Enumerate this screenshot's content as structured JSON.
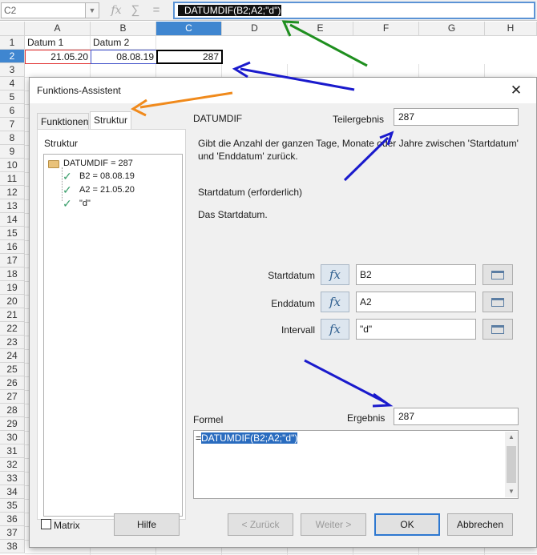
{
  "formula_bar": {
    "name_box": "C2",
    "fx_icon": "fx-icon",
    "sum_icon": "sum-icon",
    "equals_icon": "equals-icon",
    "formula": "=DATUMDIF(B2;A2;\"d\")",
    "formula_prefix": "=",
    "formula_rest": "DATUMDIF(B2;A2;\"d\")"
  },
  "sheet": {
    "columns": [
      "A",
      "B",
      "C",
      "D",
      "E",
      "F",
      "G",
      "H"
    ],
    "selected_column": "C",
    "rows": [
      "1",
      "2",
      "3",
      "4",
      "5",
      "6",
      "7",
      "8",
      "9",
      "10",
      "11",
      "12",
      "13",
      "14",
      "15",
      "16",
      "17",
      "18",
      "19",
      "20",
      "21",
      "22",
      "23",
      "24",
      "25",
      "26",
      "27",
      "28",
      "29",
      "30",
      "31",
      "32",
      "33",
      "34",
      "35",
      "36",
      "37",
      "38"
    ],
    "selected_row": "2",
    "cells": {
      "A1": "Datum 1",
      "B1": "Datum 2",
      "A2": "21.05.20",
      "B2": "08.08.19",
      "C2": "287"
    }
  },
  "dialog": {
    "title": "Funktions-Assistent",
    "close_icon": "close-icon",
    "tabs": [
      {
        "label": "Funktionen",
        "active": false
      },
      {
        "label": "Struktur",
        "active": true
      }
    ],
    "structure_label": "Struktur",
    "tree": [
      {
        "label": "DATUMDIF = 287",
        "icon": "folder-icon"
      },
      {
        "label": "B2 = 08.08.19",
        "icon": "check-icon"
      },
      {
        "label": "A2 = 21.05.20",
        "icon": "check-icon"
      },
      {
        "label": "\"d\"",
        "icon": "check-icon"
      }
    ],
    "function_name": "DATUMDIF",
    "teilergebnis_label": "Teilergebnis",
    "teilergebnis_value": "287",
    "description": "Gibt die Anzahl der ganzen Tage, Monate oder Jahre zwischen 'Startdatum' und 'Enddatum' zurück.",
    "arg_title": "Startdatum (erforderlich)",
    "arg_description": "Das Startdatum.",
    "arguments": [
      {
        "label": "Startdatum",
        "value": "B2"
      },
      {
        "label": "Enddatum",
        "value": "A2"
      },
      {
        "label": "Intervall",
        "value": "\"d\""
      }
    ],
    "fx_label": "fx",
    "formel_label": "Formel",
    "ergebnis_label": "Ergebnis",
    "ergebnis_value": "287",
    "formula_prefix": "=",
    "formula_rest": "DATUMDIF(B2;A2;\"d\")",
    "matrix_label": "Matrix",
    "buttons": {
      "hilfe": "Hilfe",
      "zurueck": "< Zurück",
      "weiter": "Weiter >",
      "ok": "OK",
      "abbrechen": "Abbrechen"
    }
  },
  "annotations": {
    "green": "#1f8f1f",
    "blue": "#1a1acc",
    "orange": "#f08a1c"
  }
}
